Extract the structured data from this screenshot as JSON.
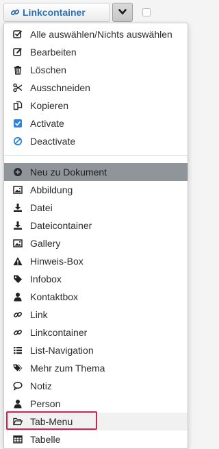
{
  "topbar": {
    "button_label": "Linkcontainer",
    "link_icon": "link-icon",
    "caret_icon": "chevron-down-icon"
  },
  "menu": {
    "actions": [
      {
        "label": "Alle auswählen/Nichts auswählen",
        "icon": "check-square-icon"
      },
      {
        "label": "Bearbeiten",
        "icon": "edit-icon"
      },
      {
        "label": "Löschen",
        "icon": "trash-icon"
      },
      {
        "label": "Ausschneiden",
        "icon": "scissors-icon"
      },
      {
        "label": "Kopieren",
        "icon": "copy-icon"
      },
      {
        "label": "Activate",
        "icon": "checkbox-checked-icon"
      },
      {
        "label": "Deactivate",
        "icon": "ban-icon"
      }
    ],
    "section_header": {
      "label": "Neu zu Dokument",
      "icon": "plus-circle-icon"
    },
    "types": [
      {
        "label": "Abbildung",
        "icon": "image-icon"
      },
      {
        "label": "Datei",
        "icon": "download-icon"
      },
      {
        "label": "Dateicontainer",
        "icon": "download-icon"
      },
      {
        "label": "Gallery",
        "icon": "image-icon"
      },
      {
        "label": "Hinweis-Box",
        "icon": "warning-icon"
      },
      {
        "label": "Infobox",
        "icon": "tag-icon"
      },
      {
        "label": "Kontaktbox",
        "icon": "user-icon"
      },
      {
        "label": "Link",
        "icon": "link-icon"
      },
      {
        "label": "Linkcontainer",
        "icon": "link-icon"
      },
      {
        "label": "List-Navigation",
        "icon": "list-icon"
      },
      {
        "label": "Mehr zum Thema",
        "icon": "tags-icon"
      },
      {
        "label": "Notiz",
        "icon": "comment-icon"
      },
      {
        "label": "Person",
        "icon": "user-icon"
      },
      {
        "label": "Tab-Menu",
        "icon": "folder-open-icon"
      },
      {
        "label": "Tabelle",
        "icon": "table-icon"
      }
    ]
  },
  "colors": {
    "link_blue": "#2b6fb3",
    "checkbox_blue": "#2f84d6",
    "header_bg": "#8f959b",
    "highlight_red": "#d6204e"
  }
}
